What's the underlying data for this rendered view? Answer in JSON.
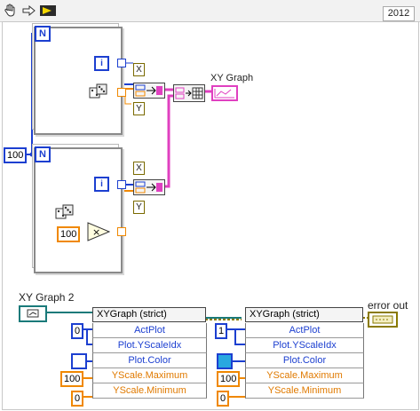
{
  "toolbar": {
    "icons": [
      "hand-icon",
      "arrow-right-icon",
      "run-arrow-icon"
    ],
    "version": "2012"
  },
  "loop1": {
    "count_label": "N",
    "iter_label": "i",
    "x_label": "X",
    "y_label": "Y"
  },
  "loop2": {
    "count_label": "N",
    "iter_label": "i",
    "x_label": "X",
    "y_label": "Y",
    "multiplier": "100",
    "multiply_op": "×"
  },
  "count_constant": "100",
  "xy_graph_label": "XY Graph",
  "xy_graph2_label": "XY Graph 2",
  "error_out_label": "error out",
  "property_node_1": {
    "header": "XYGraph (strict)",
    "properties": [
      "ActPlot",
      "Plot.YScaleIdx",
      "Plot.Color",
      "YScale.Maximum",
      "YScale.Minimum"
    ],
    "inputs": {
      "act_plot": "0",
      "y_max": "100",
      "y_min": "0",
      "color": "#1c3fd0"
    }
  },
  "property_node_2": {
    "header": "XYGraph (strict)",
    "properties": [
      "ActPlot",
      "Plot.YScaleIdx",
      "Plot.Color",
      "YScale.Maximum",
      "YScale.Minimum"
    ],
    "inputs": {
      "act_plot": "1",
      "y_max": "100",
      "y_min": "0",
      "color": "#29a8e0"
    }
  },
  "colors": {
    "blue_wire": "#1c3fd0",
    "orange_wire": "#f08800",
    "pink_wire": "#e040c0",
    "cluster_wire": "#8a7a00"
  }
}
